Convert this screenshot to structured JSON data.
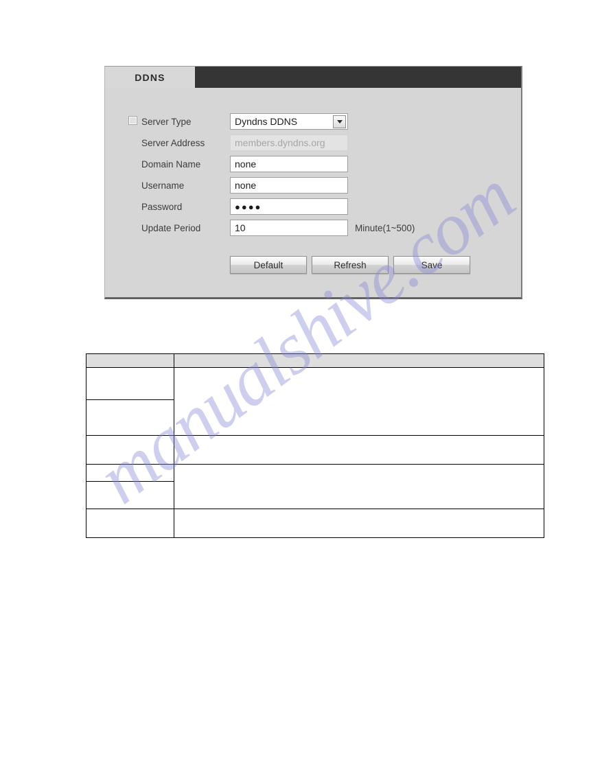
{
  "panel": {
    "tab": {
      "label": "DDNS"
    },
    "rows": [
      {
        "id": "server-type",
        "label": "Server Type",
        "value": "Dyndns DDNS",
        "kind": "select",
        "has_checkbox": true,
        "checked": false,
        "disabled": false,
        "unit": ""
      },
      {
        "id": "server-address",
        "label": "Server Address",
        "value": "members.dyndns.org",
        "kind": "text",
        "has_checkbox": false,
        "checked": false,
        "disabled": true,
        "unit": ""
      },
      {
        "id": "domain-name",
        "label": "Domain Name",
        "value": "none",
        "kind": "text",
        "has_checkbox": false,
        "checked": false,
        "disabled": false,
        "unit": ""
      },
      {
        "id": "username",
        "label": "Username",
        "value": "none",
        "kind": "text",
        "has_checkbox": false,
        "checked": false,
        "disabled": false,
        "unit": ""
      },
      {
        "id": "password",
        "label": "Password",
        "value": "●●●●",
        "kind": "password",
        "has_checkbox": false,
        "checked": false,
        "disabled": false,
        "unit": ""
      },
      {
        "id": "update-period",
        "label": "Update Period",
        "value": "10",
        "kind": "text",
        "has_checkbox": false,
        "checked": false,
        "disabled": false,
        "unit": "Minute(1~500)"
      }
    ],
    "buttons": [
      {
        "id": "default",
        "label": "Default"
      },
      {
        "id": "refresh",
        "label": "Refresh"
      },
      {
        "id": "save",
        "label": "Save"
      }
    ],
    "select_options": [
      "Dyndns DDNS"
    ]
  },
  "desc_table": {
    "headers": [
      "",
      ""
    ],
    "rows": [
      {
        "param": "",
        "func": "",
        "param_rowspan": 1,
        "func_rowspan": 2
      },
      {
        "param": "",
        "func": null,
        "param_rowspan": 1,
        "func_rowspan": 0
      },
      {
        "param": "",
        "func": "",
        "param_rowspan": 1,
        "func_rowspan": 1
      },
      {
        "param": "",
        "func": "",
        "param_rowspan": 1,
        "func_rowspan": 2
      },
      {
        "param": "",
        "func": null,
        "param_rowspan": 1,
        "func_rowspan": 0
      },
      {
        "param": "",
        "func": "",
        "param_rowspan": 1,
        "func_rowspan": 1
      }
    ]
  },
  "watermark": {
    "text": "manualshive.com",
    "color": "#8585d6"
  }
}
